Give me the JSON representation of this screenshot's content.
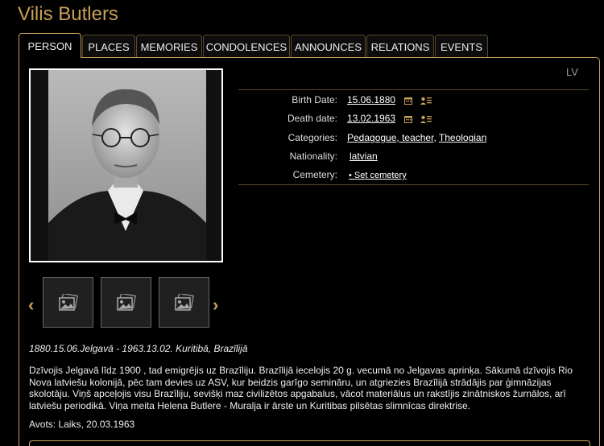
{
  "person": {
    "name": "Vilis Butlers"
  },
  "tabs": [
    {
      "label": "PERSON"
    },
    {
      "label": "PLACES"
    },
    {
      "label": "MEMORIES"
    },
    {
      "label": "CONDOLENCES"
    },
    {
      "label": "ANNOUNCES"
    },
    {
      "label": "RELATIONS"
    },
    {
      "label": "EVENTS"
    }
  ],
  "language": "LV",
  "details": {
    "birth_label": "Birth Date:",
    "birth_value": "15.06.1880",
    "death_label": "Death date:",
    "death_value": "13.02.1963",
    "categories_label": "Categories:",
    "categories": [
      "Pedagogue, teacher",
      "Theologian"
    ],
    "nationality_label": "Nationality:",
    "nationality_value": "latvian",
    "cemetery_label": "Cemetery:",
    "cemetery_link": "• Set cemetery"
  },
  "icons": {
    "calendar": "calendar-icon",
    "person_list": "person-list-icon",
    "gallery_placeholder": "image-gallery-icon",
    "prev": "chevron-left-icon",
    "next": "chevron-right-icon"
  },
  "nav": {
    "prev": "‹",
    "next": "›"
  },
  "caption": "1880.15.06.Jelgavā - 1963.13.02. Kuritibā, Brazīlijā",
  "bio": "Dzīvojis Jelgavā līdz 1900 , tad emigrējis uz Brazīliju. Brazīlijā iecelojis 20 g. vecumā no Jelgavas aprinķa. Sākumā dzīvojis Rio Nova latviešu kolonijā, pēc tam devies uz ASV, kur beidzis garīgo semināru, un atgriezies Brazīlijā strādājis par ģimnāzijas skolotāju. Viņš apceļojis visu Brazīliju, sevišķi maz civilizētos apgabalus, vācot materiālus un rakstījis zinātniskos žurnālos, arī latviešu periodikā. Viņa meita Helena Butlere - Muralja ir ārste un Kuritibas pilsētas slimnīcas direktrise.",
  "source": "Avots: Laiks, 20.03.1963",
  "colors": {
    "accent": "#c9a05a",
    "background": "#000000",
    "text": "#dddddd"
  }
}
